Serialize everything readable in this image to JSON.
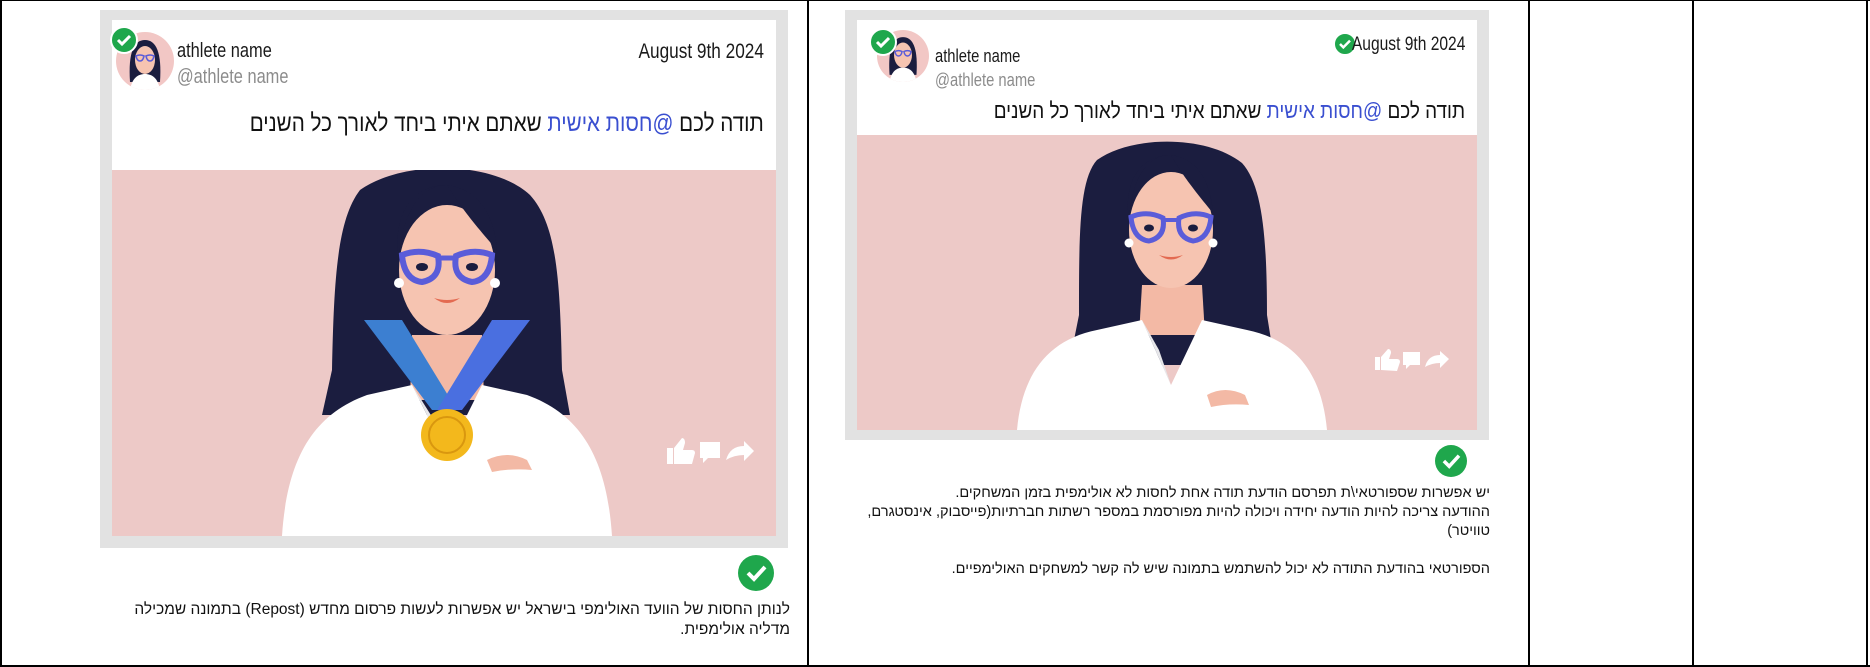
{
  "left_post": {
    "athlete_name": "athlete name",
    "handle": "@athlete name",
    "date": "August 9th 2024",
    "message_prefix": "תודה לכם",
    "message_mention": "@חסות אישית",
    "message_suffix": "שאתם איתי ביחד לאורך כל השנים",
    "avatar_icon": "woman-avatar-icon",
    "verified_icon": "check-circle-icon",
    "includes_medal": true,
    "note_lines": [
      "לנותן החסות של הוועד האולימפי בישראל יש אפשרות לעשות פרסום מחדש (Repost) בתמונה שמכילה",
      "מדליה אולימפית."
    ]
  },
  "right_post": {
    "athlete_name": "athlete name",
    "handle": "@athlete name",
    "date": "August 9th 2024",
    "message_prefix": "תודה לכם",
    "message_mention": "@חסות אישית",
    "message_suffix": "שאתם איתי ביחד לאורך כל השנים",
    "avatar_icon": "woman-avatar-icon",
    "verified_icon": "check-circle-icon",
    "includes_medal": false,
    "note_lines": [
      "יש אפשרות שספורטאי\\ת תפרסם הודעת תודה אחת לחסות לא אולימפית בזמן המשחקים.",
      "ההודעה צריכה להיות הודעה יחידה ויכולה להיות מפורסמת במספר רשתות חברתיות(פייסבוק, אינסטגרם, טוויטר)",
      "",
      "הספורטאי בהודעת התודה לא יכול להשתמש בתמונה שיש לה קשר למשחקים האולימפיים."
    ]
  },
  "colors": {
    "mention": "#3a4fd0",
    "verified": "#1fa74c",
    "scene_bg": "#edc9c7",
    "card_frame": "#e2e2e2"
  }
}
